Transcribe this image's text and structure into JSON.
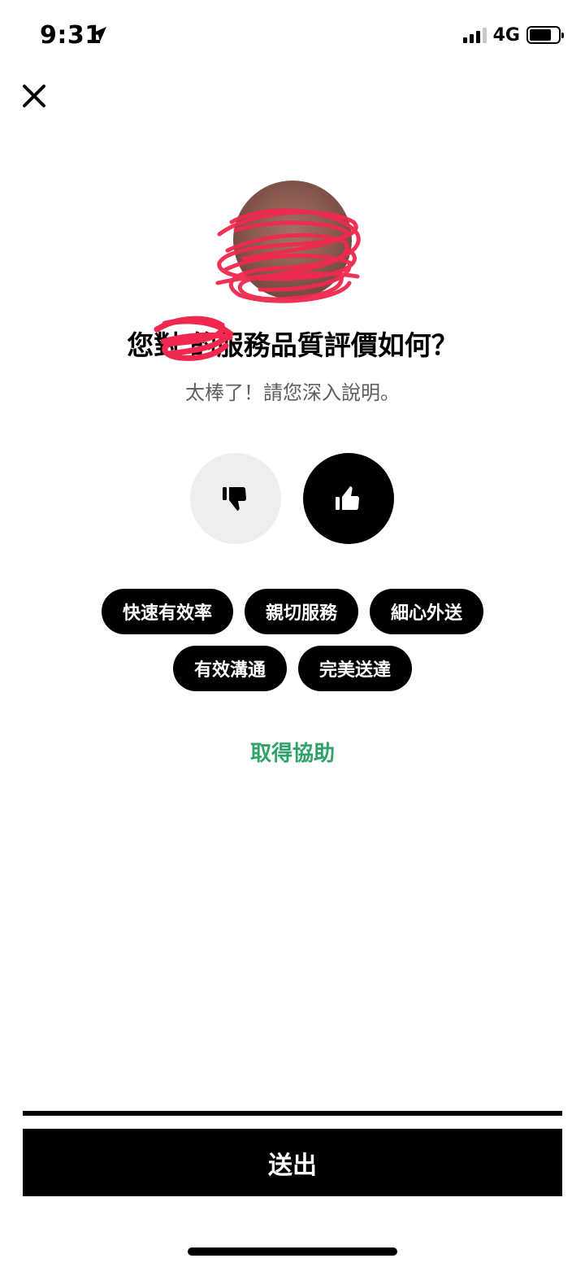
{
  "status_bar": {
    "time": "9:31",
    "network": "4G"
  },
  "header": {
    "close_icon": "close-icon"
  },
  "rating": {
    "title": "您對 的服務品質評價如何？",
    "subtitle": "太棒了！請您深入說明。",
    "thumbs_down_icon": "thumbs-down-icon",
    "thumbs_up_icon": "thumbs-up-icon",
    "selected": "thumbs-up"
  },
  "tags": {
    "row1": [
      "快速有效率",
      "親切服務",
      "細心外送"
    ],
    "row2": [
      "有效溝通",
      "完美送達"
    ]
  },
  "help_link": "取得協助",
  "submit_label": "送出",
  "colors": {
    "accent_green": "#2ea367",
    "primary": "#000000",
    "unselected": "#eeeeee"
  }
}
